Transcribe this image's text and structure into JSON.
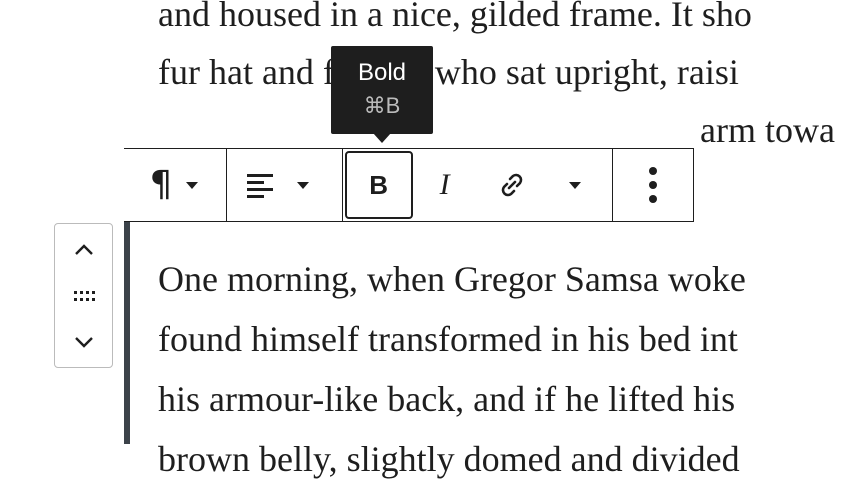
{
  "content": {
    "top_lines": [
      "and housed in a nice, gilded frame. It sho",
      "fur hat and fur boa who sat upright, raisi",
      "arm towa"
    ],
    "paragraph_lines": [
      "One morning, when Gregor Samsa woke",
      "found himself transformed in his bed int",
      "his armour-like back, and if he lifted his ",
      "brown belly, slightly domed and divided"
    ]
  },
  "tooltip": {
    "label": "Bold",
    "shortcut": "⌘B"
  },
  "toolbar": {
    "paragraph_icon": "pilcrow-icon",
    "align_icon": "align-left-icon",
    "bold_label": "B",
    "italic_label": "I",
    "link_icon": "link-icon",
    "more_icon": "more-vertical-icon"
  },
  "mover": {
    "up_icon": "chevron-up-icon",
    "drag_icon": "drag-handle-icon",
    "down_icon": "chevron-down-icon"
  },
  "colors": {
    "text": "#1e1e1e",
    "tooltip_bg": "#1e1e1e",
    "tooltip_shortcut": "#bbbbbb",
    "block_bar": "#3c434a",
    "mover_border": "#bbbbbb"
  }
}
